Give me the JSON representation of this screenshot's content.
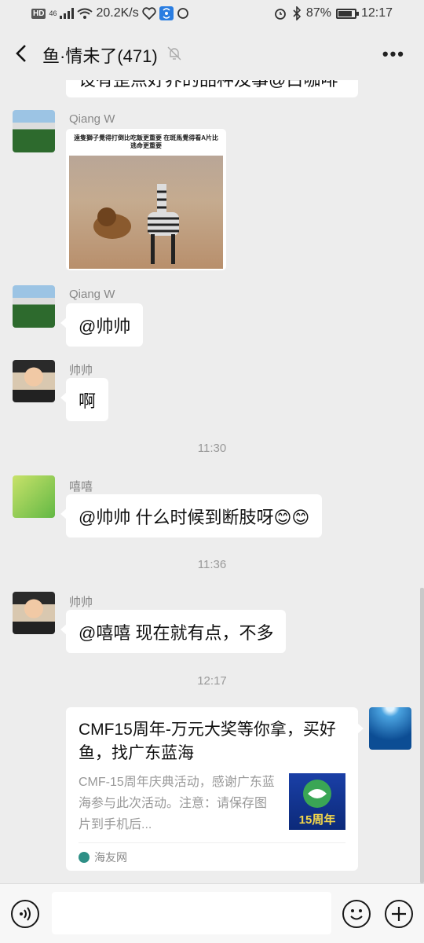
{
  "status_bar": {
    "network_speed": "20.2K/s",
    "battery": "87%",
    "battery_level": 0.87,
    "time": "12:17",
    "hd": "HD",
    "signal": "46"
  },
  "header": {
    "title": "鱼·情未了(471)"
  },
  "messages": {
    "partial_text": "设有歪点好养的品种及事@白咖啡",
    "m1": {
      "sender": "Qiang W",
      "image_caption": "遠隻獅子覺得打倒比吃飯更重要 在斑馬覺得看A片比逃命更重要"
    },
    "m2": {
      "sender": "Qiang W",
      "text": "@帅帅"
    },
    "m3": {
      "sender": "帅帅",
      "text": "啊"
    },
    "time1": "11:30",
    "m4": {
      "sender": "嘻嘻",
      "text": "@帅帅  什么时候到断肢呀😊😊"
    },
    "time2": "11:36",
    "m5": {
      "sender": "帅帅",
      "text": "@嘻嘻  现在就有点，不多"
    },
    "time3": "12:17",
    "card": {
      "title": "CMF15周年-万元大奖等你拿，买好鱼，找广东蓝海",
      "description": "CMF-15周年庆典活动，感谢广东蓝海参与此次活动。注意：请保存图片到手机后...",
      "thumb_label": "15周年",
      "source": "海友网"
    }
  }
}
